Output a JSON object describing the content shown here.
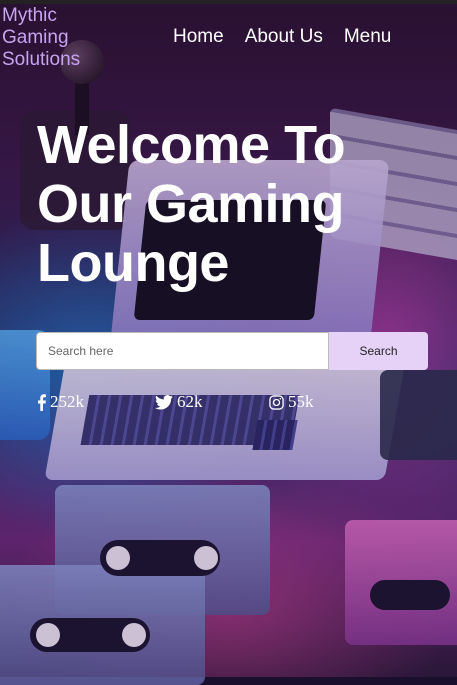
{
  "brand": {
    "name": "Mythic\nGaming\nSolutions",
    "color": "#c7a3f0"
  },
  "nav": {
    "items": [
      {
        "label": "Home"
      },
      {
        "label": "About Us"
      },
      {
        "label": "Menu"
      }
    ]
  },
  "hero": {
    "title": "Welcome To Our Gaming Lounge"
  },
  "search": {
    "placeholder": "Search here",
    "button_label": "Search",
    "button_color": "#e6d2f7"
  },
  "socials": [
    {
      "icon": "facebook-icon",
      "count": "252k"
    },
    {
      "icon": "twitter-icon",
      "count": "62k"
    },
    {
      "icon": "instagram-icon",
      "count": "55k"
    }
  ]
}
